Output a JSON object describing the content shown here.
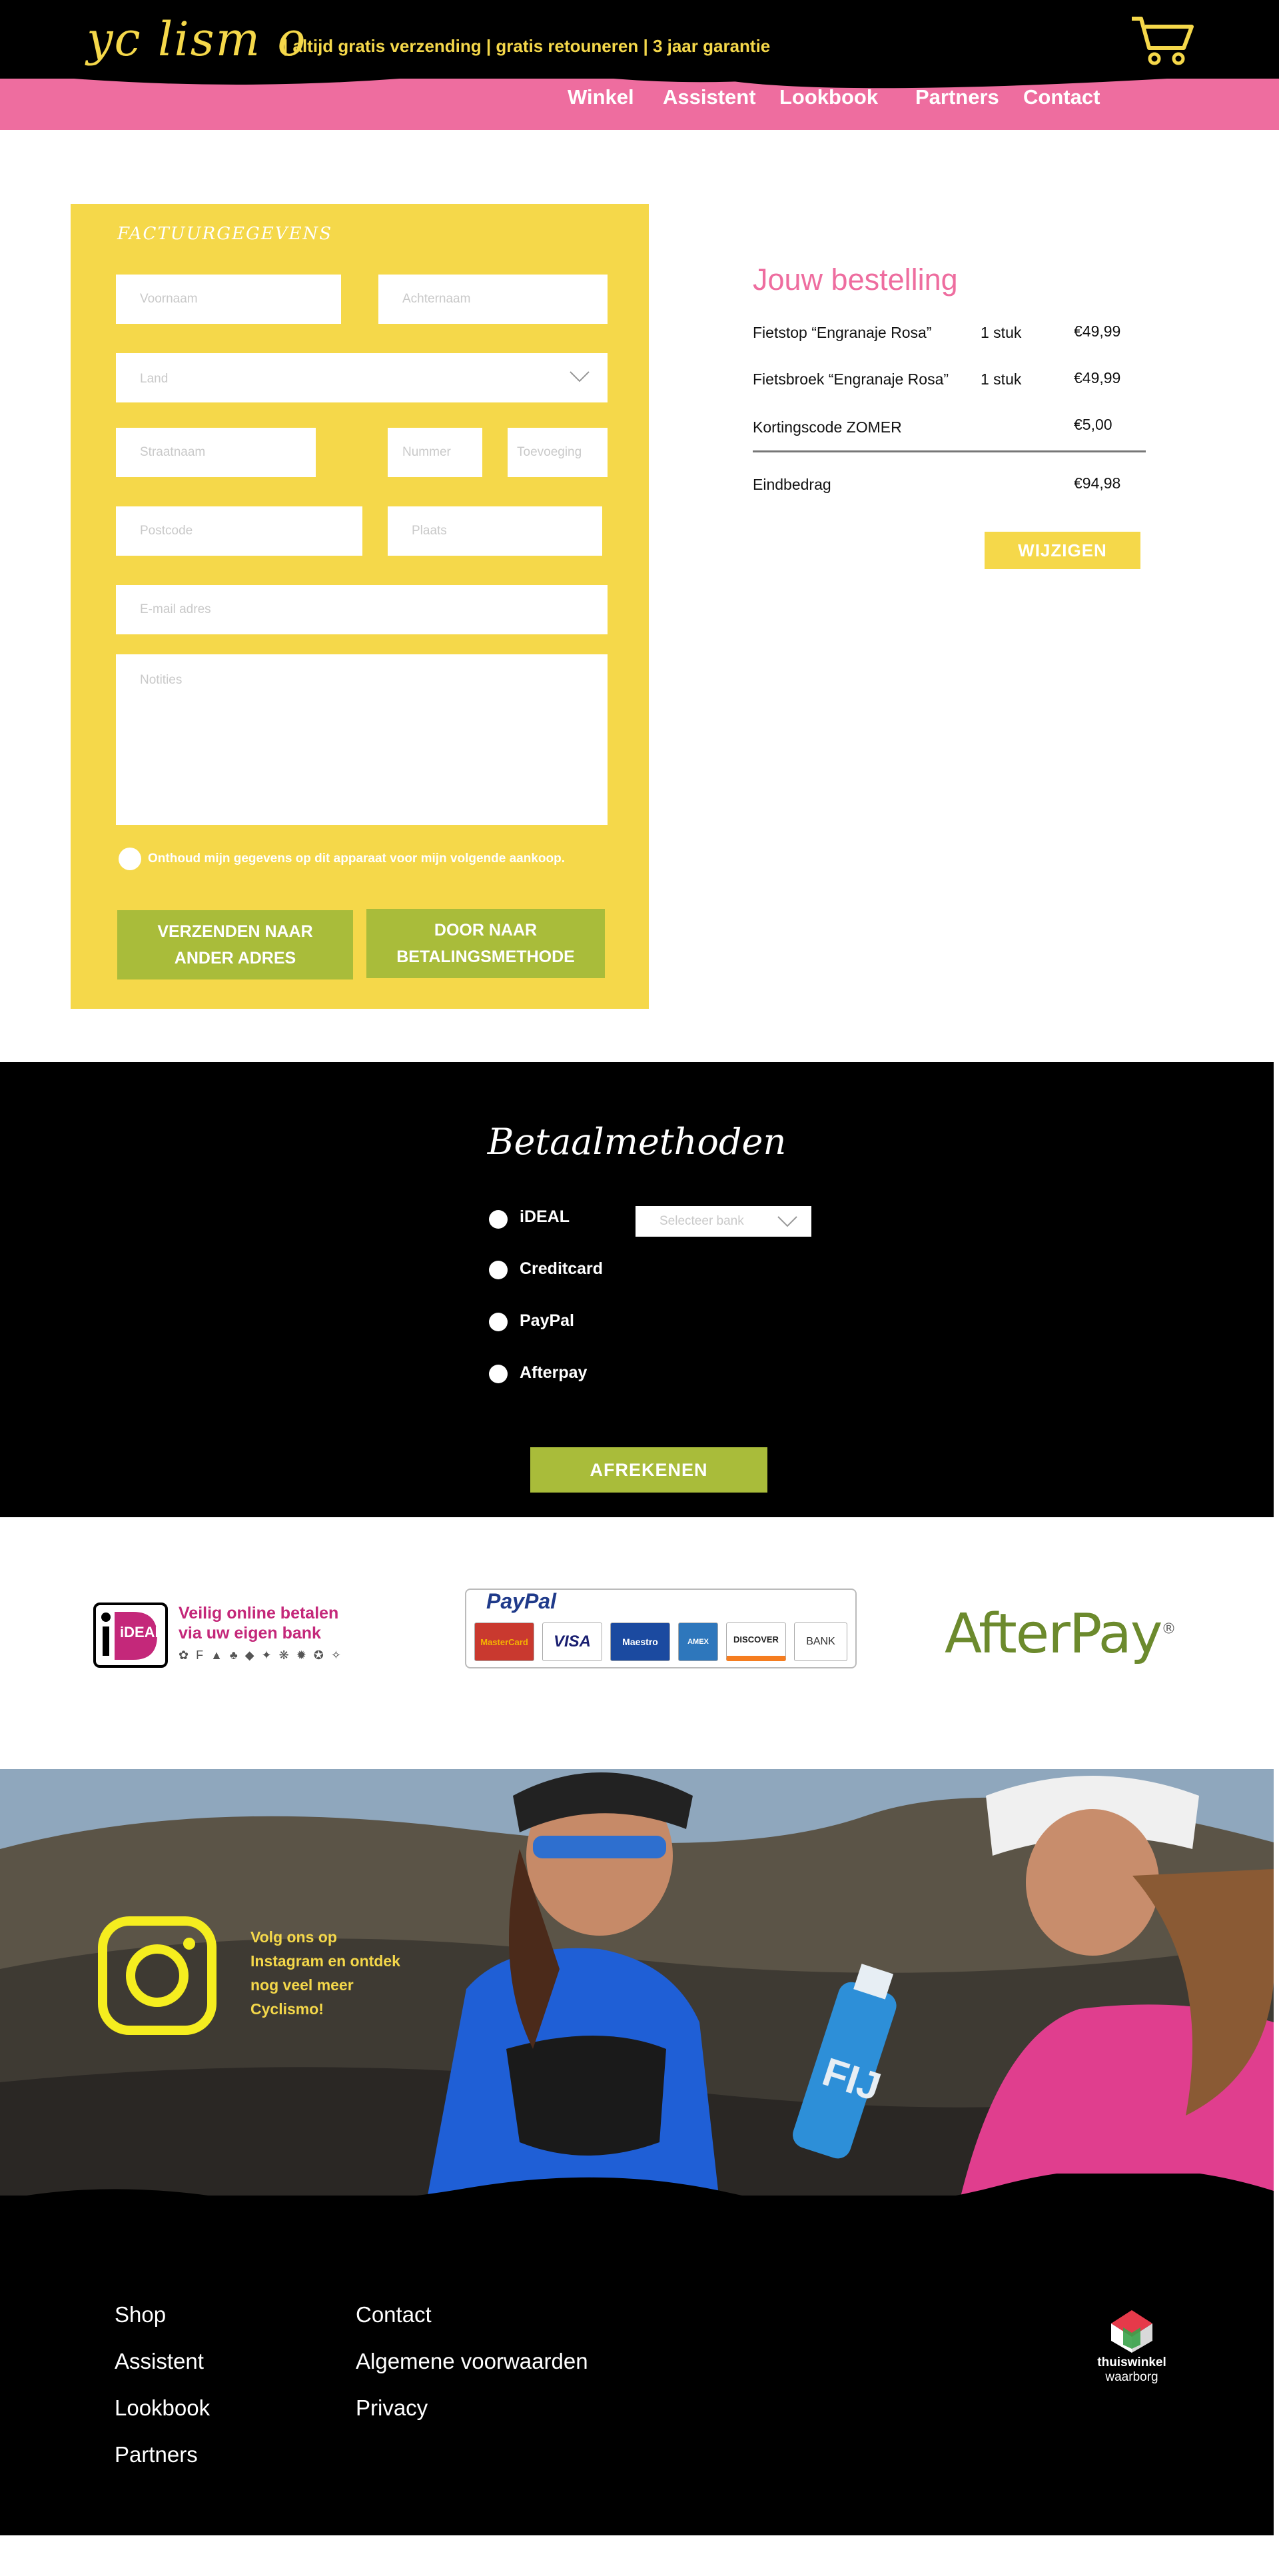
{
  "header": {
    "logo_text": "yc lism o",
    "usp": "| altijd gratis verzending | gratis retouneren | 3 jaar garantie",
    "nav": [
      {
        "label": "Winkel"
      },
      {
        "label": "Assistent"
      },
      {
        "label": "Lookbook"
      },
      {
        "label": "Partners"
      },
      {
        "label": "Contact"
      }
    ]
  },
  "billing": {
    "title": "FACTUURGEGEVENS",
    "placeholders": {
      "voornaam": "Voornaam",
      "achternaam": "Achternaam",
      "land": "Land",
      "straatnaam": "Straatnaam",
      "nummer": "Nummer",
      "toevoeging": "Toevoeging",
      "postcode": "Postcode",
      "plaats": "Plaats",
      "email": "E-mail adres",
      "notities": "Notities"
    },
    "remember": "Onthoud mijn gegevens op dit apparaat voor mijn volgende aankoop.",
    "btn_other_address_1": "VERZENDEN NAAR",
    "btn_other_address_2": "ANDER ADRES",
    "btn_payment_1": "DOOR NAAR",
    "btn_payment_2": "BETALINGSMETHODE"
  },
  "order": {
    "title": "Jouw bestelling",
    "items": [
      {
        "name": "Fietstop “Engranaje Rosa”",
        "qty": "1 stuk",
        "price": "€49,99"
      },
      {
        "name": "Fietsbroek “Engranaje Rosa”",
        "qty": "1 stuk",
        "price": "€49,99"
      },
      {
        "name": "Kortingscode ZOMER",
        "qty": "",
        "price": "€5,00"
      }
    ],
    "total_label": "Eindbedrag",
    "total_value": "€94,98",
    "change_label": "WIJZIGEN"
  },
  "payment": {
    "title": "Betaalmethoden",
    "methods": [
      {
        "label": "iDEAL"
      },
      {
        "label": "Creditcard"
      },
      {
        "label": "PayPal"
      },
      {
        "label": "Afterpay"
      }
    ],
    "bank_placeholder": "Selecteer bank",
    "checkout_label": "AFREKENEN"
  },
  "logos": {
    "ideal_badge": "iDEAL",
    "ideal_line1": "Veilig online betalen",
    "ideal_line2": "via uw eigen bank",
    "paypal": "PayPal",
    "cards": [
      "MasterCard",
      "VISA",
      "Maestro",
      "AMEX",
      "DISCOVER",
      "BANK"
    ],
    "afterpay": "AfterPay",
    "afterpay_mark": "®"
  },
  "instagram": {
    "text": "Volg ons op Instagram en ontdek nog veel meer Cyclismo!",
    "bottle_text": "FIJ"
  },
  "footer": {
    "col1": [
      {
        "label": "Shop"
      },
      {
        "label": "Assistent"
      },
      {
        "label": "Lookbook"
      },
      {
        "label": "Partners"
      }
    ],
    "col2": [
      {
        "label": "Contact"
      },
      {
        "label": "Algemene voorwaarden"
      },
      {
        "label": "Privacy"
      }
    ],
    "trust_line1": "thuiswinkel",
    "trust_line2": "waarborg"
  },
  "colors": {
    "pink": "#ee6d9f",
    "yellow": "#f5d84a",
    "green": "#a9bc3a",
    "black": "#000000"
  }
}
